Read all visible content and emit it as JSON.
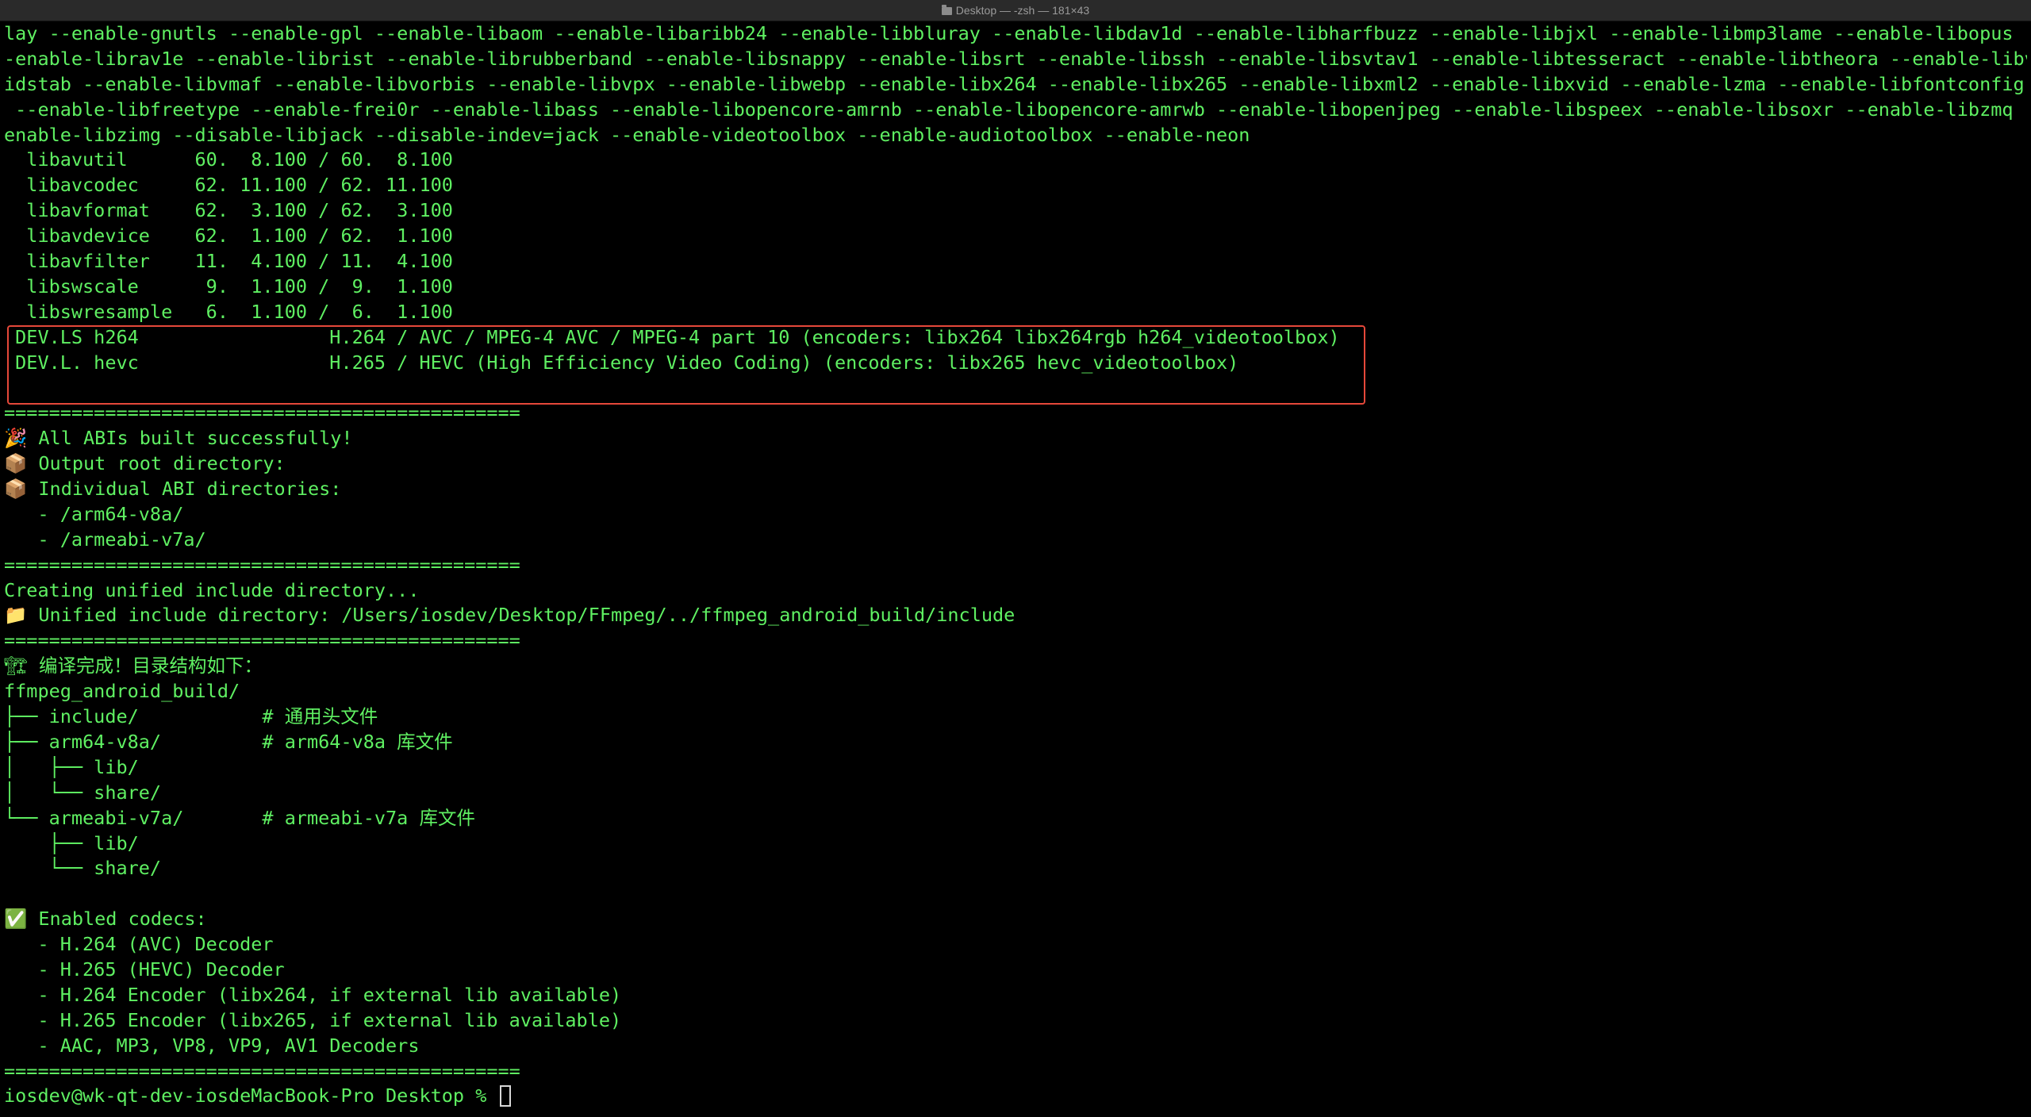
{
  "window": {
    "title": "Desktop — -zsh — 181×43"
  },
  "terminal": {
    "lines": [
      "lay --enable-gnutls --enable-gpl --enable-libaom --enable-libaribb24 --enable-libbluray --enable-libdav1d --enable-libharfbuzz --enable-libjxl --enable-libmp3lame --enable-libopus -",
      "-enable-librav1e --enable-librist --enable-librubberband --enable-libsnappy --enable-libsrt --enable-libssh --enable-libsvtav1 --enable-libtesseract --enable-libtheora --enable-libv",
      "idstab --enable-libvmaf --enable-libvorbis --enable-libvpx --enable-libwebp --enable-libx264 --enable-libx265 --enable-libxml2 --enable-libxvid --enable-lzma --enable-libfontconfig",
      " --enable-libfreetype --enable-frei0r --enable-libass --enable-libopencore-amrnb --enable-libopencore-amrwb --enable-libopenjpeg --enable-libspeex --enable-libsoxr --enable-libzmq --",
      "enable-libzimg --disable-libjack --disable-indev=jack --enable-videotoolbox --enable-audiotoolbox --enable-neon",
      "  libavutil      60.  8.100 / 60.  8.100",
      "  libavcodec     62. 11.100 / 62. 11.100",
      "  libavformat    62.  3.100 / 62.  3.100",
      "  libavdevice    62.  1.100 / 62.  1.100",
      "  libavfilter    11.  4.100 / 11.  4.100",
      "  libswscale      9.  1.100 /  9.  1.100",
      "  libswresample   6.  1.100 /  6.  1.100",
      " DEV.LS h264                 H.264 / AVC / MPEG-4 AVC / MPEG-4 part 10 (encoders: libx264 libx264rgb h264_videotoolbox)",
      " DEV.L. hevc                 H.265 / HEVC (High Efficiency Video Coding) (encoders: libx265 hevc_videotoolbox)",
      "",
      "==============================================",
      "🎉 All ABIs built successfully!",
      "📦 Output root directory:",
      "📦 Individual ABI directories:",
      "   - /arm64-v8a/",
      "   - /armeabi-v7a/",
      "==============================================",
      "Creating unified include directory...",
      "📁 Unified include directory: /Users/iosdev/Desktop/FFmpeg/../ffmpeg_android_build/include",
      "==============================================",
      "🏗 编译完成！目录结构如下：",
      "ffmpeg_android_build/",
      "├── include/           # 通用头文件",
      "├── arm64-v8a/         # arm64-v8a 库文件",
      "│   ├── lib/",
      "│   └── share/",
      "└── armeabi-v7a/       # armeabi-v7a 库文件",
      "    ├── lib/",
      "    └── share/",
      "",
      "✅ Enabled codecs:",
      "   - H.264 (AVC) Decoder",
      "   - H.265 (HEVC) Decoder",
      "   - H.264 Encoder (libx264, if external lib available)",
      "   - H.265 Encoder (libx265, if external lib available)",
      "   - AAC, MP3, VP8, VP9, AV1 Decoders",
      "=============================================="
    ],
    "prompt": "iosdev@wk-qt-dev-iosdeMacBook-Pro Desktop % "
  },
  "colors": {
    "background": "#000000",
    "text": "#5ff062",
    "highlight_border": "#e5483a",
    "title_text": "#9a9a9a"
  },
  "icons": {
    "title": "folder-icon",
    "cursor": "block-cursor"
  }
}
